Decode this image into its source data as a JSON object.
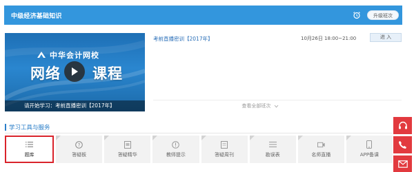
{
  "header": {
    "title": "中级经济基础知识",
    "alarm_icon": "alarm-clock-icon",
    "upgrade_label": "升级班次"
  },
  "video": {
    "brand": "中华会计网校",
    "course_title": "网络",
    "course_title_tail": "课程",
    "caption_prefix": "请开始学习：",
    "caption_course": "考前直播密训【2017年】",
    "play_icon": "play-icon"
  },
  "course": {
    "name": "考前直播密训【2017年】",
    "time": "10月26日 18:00~21:00",
    "enter_label": "进 入"
  },
  "view_all": "查看全部班次",
  "section": {
    "title": "学习工具与服务"
  },
  "tools": [
    {
      "label": "题库",
      "icon": "list-icon"
    },
    {
      "label": "答疑板",
      "icon": "question-circle-icon"
    },
    {
      "label": "答疑精华",
      "icon": "document-box-icon"
    },
    {
      "label": "教师提示",
      "icon": "info-circle-icon"
    },
    {
      "label": "答疑周刊",
      "icon": "document-box-icon"
    },
    {
      "label": "勘误表",
      "icon": "list-icon"
    },
    {
      "label": "名师直播",
      "icon": "video-camera-icon"
    },
    {
      "label": "APP备课",
      "icon": "mobile-phone-icon"
    }
  ],
  "side": [
    "headset-icon",
    "phone-icon",
    "mail-icon"
  ],
  "colors": {
    "header_bg": "#3396dd",
    "accent_red": "#e23a3f",
    "link_blue": "#2a6fb8"
  }
}
